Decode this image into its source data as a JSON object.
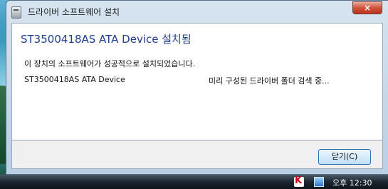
{
  "window": {
    "title": "드라이버 소프트웨어 설치",
    "close_glyph": "×"
  },
  "content": {
    "heading": "ST3500418AS ATA Device 설치됨",
    "message": "이 장치의 소프트웨어가 성공적으로 설치되었습니다.",
    "device_row": {
      "name": "ST3500418AS ATA Device",
      "status": "미리 구성된 드라이버 폴더 검색 중..."
    }
  },
  "footer": {
    "close_label": "닫기(C)"
  },
  "taskbar": {
    "av_icon_glyph": "K",
    "clock": "오후 12:30"
  },
  "colors": {
    "heading": "#1e3d8f",
    "close_button": "#c8442c",
    "taskbar": "#1c2630"
  },
  "icons": [
    "installer-icon",
    "close-icon",
    "antivirus-tray-icon",
    "network-tray-icon"
  ]
}
